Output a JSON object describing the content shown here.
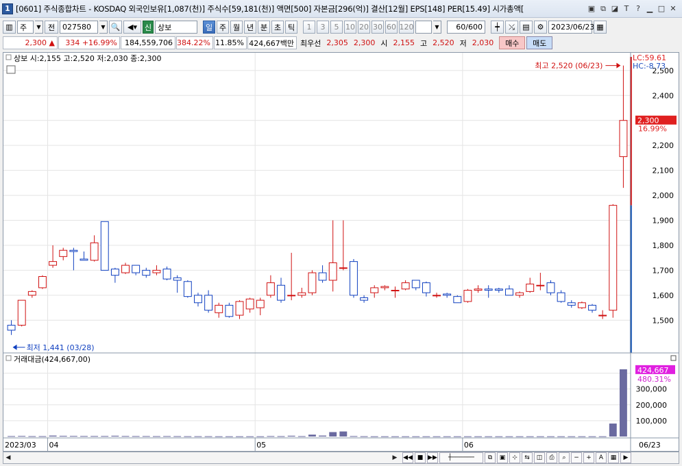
{
  "window": {
    "number": "1",
    "title": "[0601] 주식종합차트 - KOSDAQ 외국인보유[1,087(천)] 주식수[59,181(천)] 액면[500] 자본금[296(억)] 결산[12월] EPS[148] PER[15.49] 시가총액[",
    "icons": [
      "layout-icon",
      "restore-icon",
      "link-icon",
      "font-icon",
      "help-icon",
      "minimize-icon",
      "maximize-icon",
      "close-icon"
    ]
  },
  "toolbar": {
    "market": "주",
    "prev": "전",
    "code": "027580",
    "badge": "신",
    "name": "상보",
    "periods": [
      "일",
      "주",
      "월",
      "년",
      "분",
      "초",
      "틱"
    ],
    "selected_period": "일",
    "intervals": [
      "1",
      "3",
      "5",
      "10",
      "20",
      "30",
      "60",
      "120"
    ],
    "count": "60/600",
    "date": "2023/06/23"
  },
  "quote": {
    "price": "2,300",
    "change": "334",
    "change_pct": "+16.99%",
    "volume": "184,559,706",
    "vol_ratio": "384.22%",
    "turnover": "11.85%",
    "amount": "424,667백만",
    "best_label": "최우선",
    "ask": "2,305",
    "bid": "2,300",
    "open_label": "시",
    "open": "2,155",
    "high_label": "고",
    "high": "2,520",
    "low_label": "저",
    "low": "2,030",
    "buy": "매수",
    "sell": "매도"
  },
  "chart": {
    "legend": "상보 시:2,155 고:2,520 저:2,030 종:2,300",
    "lc_label": "LC:59.61",
    "hc_label": "HC:-8.73",
    "high_annotation": "최고 2,520 (06/23)",
    "low_annotation": "최저 1,441 (03/28)",
    "last_price_tag": "2,300",
    "last_pct_tag": "16.99%",
    "vol_legend": "거래대금(424,667,00)",
    "vol_last_tag": "424,667",
    "vol_pct_tag": "480.31%",
    "x_labels": [
      "2023/03",
      "04",
      "05",
      "06"
    ],
    "x_end_label": "06/23"
  },
  "chart_data": {
    "type": "candlestick",
    "y_ticks": [
      1500,
      1600,
      1700,
      1800,
      1900,
      2000,
      2100,
      2200,
      2300,
      2400,
      2500
    ],
    "y_tick_labels": [
      "1,500",
      "1,600",
      "1,700",
      "1,800",
      "1,900",
      "2,000",
      "2,100",
      "2,200",
      "2,300",
      "2,400",
      "2,500"
    ],
    "ylim": [
      1380,
      2560
    ],
    "candles": [
      [
        1480,
        1500,
        1441,
        1460
      ],
      [
        1480,
        1580,
        1475,
        1580
      ],
      [
        1600,
        1620,
        1590,
        1615
      ],
      [
        1630,
        1680,
        1625,
        1675
      ],
      [
        1720,
        1800,
        1710,
        1735
      ],
      [
        1755,
        1790,
        1740,
        1780
      ],
      [
        1780,
        1790,
        1700,
        1775
      ],
      [
        1745,
        1775,
        1740,
        1740
      ],
      [
        1740,
        1840,
        1735,
        1810
      ],
      [
        1895,
        1895,
        1700,
        1700
      ],
      [
        1705,
        1710,
        1650,
        1680
      ],
      [
        1690,
        1730,
        1685,
        1720
      ],
      [
        1720,
        1720,
        1680,
        1690
      ],
      [
        1700,
        1710,
        1670,
        1680
      ],
      [
        1690,
        1720,
        1680,
        1700
      ],
      [
        1705,
        1715,
        1660,
        1665
      ],
      [
        1670,
        1680,
        1610,
        1660
      ],
      [
        1655,
        1660,
        1590,
        1595
      ],
      [
        1600,
        1610,
        1555,
        1570
      ],
      [
        1600,
        1620,
        1530,
        1540
      ],
      [
        1530,
        1570,
        1510,
        1560
      ],
      [
        1560,
        1570,
        1510,
        1515
      ],
      [
        1520,
        1580,
        1505,
        1575
      ],
      [
        1545,
        1590,
        1530,
        1585
      ],
      [
        1550,
        1590,
        1520,
        1580
      ],
      [
        1600,
        1680,
        1590,
        1650
      ],
      [
        1640,
        1670,
        1570,
        1580
      ],
      [
        1600,
        1770,
        1580,
        1600
      ],
      [
        1600,
        1630,
        1590,
        1610
      ],
      [
        1610,
        1700,
        1600,
        1690
      ],
      [
        1690,
        1720,
        1650,
        1660
      ],
      [
        1660,
        1900,
        1615,
        1730
      ],
      [
        1710,
        1900,
        1700,
        1710
      ],
      [
        1735,
        1745,
        1590,
        1600
      ],
      [
        1590,
        1600,
        1570,
        1580
      ],
      [
        1610,
        1640,
        1590,
        1630
      ],
      [
        1630,
        1640,
        1620,
        1635
      ],
      [
        1620,
        1635,
        1590,
        1620
      ],
      [
        1625,
        1660,
        1620,
        1650
      ],
      [
        1660,
        1660,
        1620,
        1630
      ],
      [
        1650,
        1655,
        1595,
        1610
      ],
      [
        1600,
        1610,
        1590,
        1600
      ],
      [
        1605,
        1610,
        1590,
        1600
      ],
      [
        1595,
        1600,
        1570,
        1570
      ],
      [
        1575,
        1625,
        1570,
        1620
      ],
      [
        1620,
        1640,
        1610,
        1625
      ],
      [
        1625,
        1640,
        1590,
        1620
      ],
      [
        1625,
        1630,
        1610,
        1620
      ],
      [
        1625,
        1640,
        1600,
        1600
      ],
      [
        1600,
        1615,
        1590,
        1610
      ],
      [
        1615,
        1670,
        1610,
        1645
      ],
      [
        1640,
        1690,
        1620,
        1640
      ],
      [
        1650,
        1660,
        1600,
        1610
      ],
      [
        1610,
        1620,
        1570,
        1575
      ],
      [
        1570,
        1580,
        1550,
        1560
      ],
      [
        1550,
        1575,
        1545,
        1570
      ],
      [
        1560,
        1565,
        1530,
        1540
      ],
      [
        1520,
        1540,
        1505,
        1520
      ],
      [
        1540,
        1965,
        1510,
        1960
      ],
      [
        2155,
        2520,
        2030,
        2300
      ]
    ],
    "volume_ticks": [
      100000,
      200000,
      300000,
      400000
    ],
    "volume_tick_labels": [
      "100,000",
      "200,000",
      "300,000",
      "400,000"
    ],
    "volume_max": 450000,
    "volumes": [
      3000,
      4000,
      2500,
      2500,
      6000,
      4500,
      4000,
      3500,
      3500,
      3500,
      5000,
      3500,
      3000,
      3000,
      2500,
      3000,
      2500,
      2000,
      2000,
      2000,
      1500,
      1500,
      1500,
      1500,
      1500,
      3000,
      2500,
      5000,
      2500,
      12000,
      6000,
      28000,
      32000,
      3000,
      2000,
      1500,
      1500,
      1500,
      1500,
      1500,
      1500,
      1500,
      1500,
      1500,
      1500,
      1500,
      1500,
      1500,
      1500,
      1500,
      1500,
      1500,
      1500,
      1500,
      1500,
      1500,
      1500,
      1500,
      82000,
      424667
    ],
    "month_start_index": [
      0,
      4,
      24,
      44
    ]
  },
  "colors": {
    "up": "#d01010",
    "down": "#1040c0",
    "volume": "#6a6aa0",
    "grid": "#e4e4e4",
    "highlight_tag": "#e02020",
    "volume_tag": "#e020e0"
  }
}
